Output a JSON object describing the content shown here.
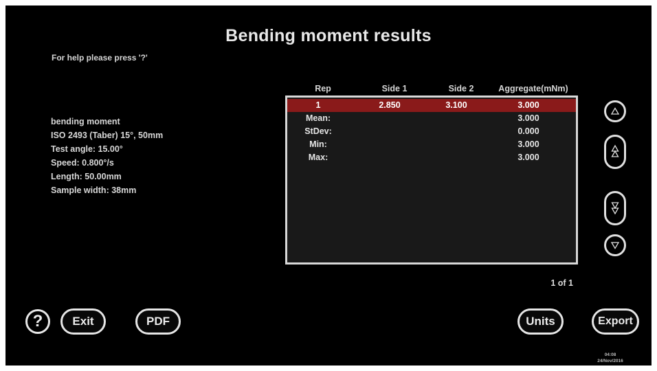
{
  "screen": {
    "title": "Bending moment results",
    "help_hint": "For help please press '?'"
  },
  "test_info": [
    "bending moment",
    "ISO 2493 (Taber) 15°, 50mm",
    "Test angle: 15.00°",
    "Speed: 0.800°/s",
    "Length: 50.00mm",
    "Sample width: 38mm"
  ],
  "results_table": {
    "columns": [
      "Rep",
      "Side 1",
      "Side 2",
      "Aggregate(mNm)"
    ],
    "rows": [
      {
        "rep": "1",
        "side1": "2.850",
        "side2": "3.100",
        "aggregate": "3.000",
        "selected": true
      }
    ],
    "stats": [
      {
        "label": "Mean:",
        "value": "3.000"
      },
      {
        "label": "StDev:",
        "value": "0.000"
      },
      {
        "label": "Min:",
        "value": "3.000"
      },
      {
        "label": "Max:",
        "value": "3.000"
      }
    ],
    "pagination": "1 of 1"
  },
  "buttons": {
    "help": "?",
    "exit": "Exit",
    "pdf": "PDF",
    "units": "Units",
    "export": "Export"
  },
  "scroll_buttons": [
    "scroll-up-icon",
    "page-up-icon",
    "page-down-icon",
    "scroll-down-icon"
  ],
  "status": {
    "time": "04:08",
    "date": "24/Nov/2016"
  },
  "colors": {
    "background": "#000000",
    "selected_row": "#8a1a1a",
    "table_background": "#191919",
    "border": "#d9d9d9",
    "text": "#e6e6e6"
  }
}
